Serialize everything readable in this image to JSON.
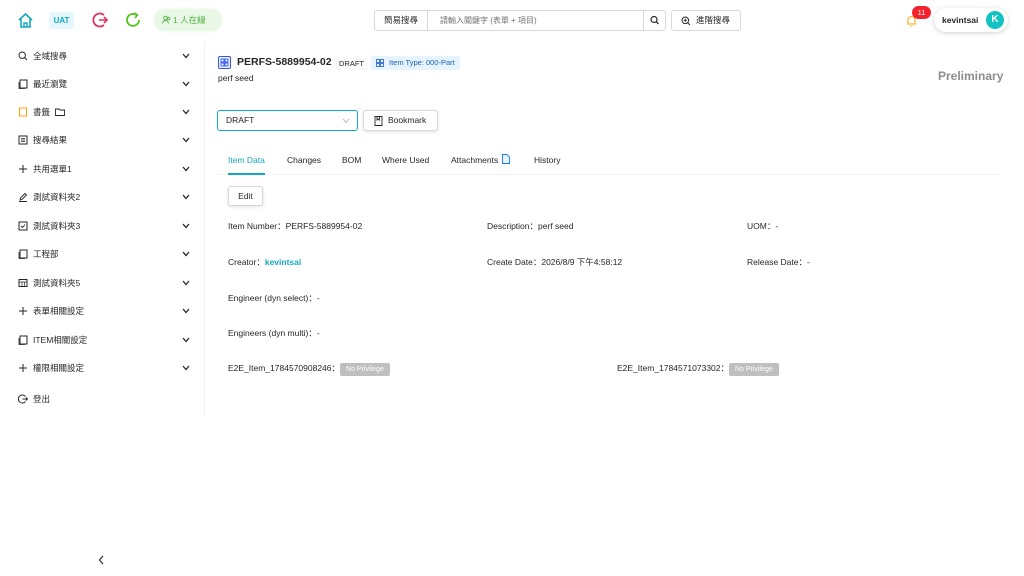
{
  "topbar": {
    "env_badge": "UAT",
    "online_users": "1 人在線",
    "search_mode": "簡易搜尋",
    "search_placeholder": "請輸入關鍵字 (表單 + 項目)",
    "advanced_search": "進階搜尋",
    "notification_count": "11",
    "username": "kevintsai",
    "avatar_initial": "K",
    "accent_color": "#13a8c2"
  },
  "sidebar": {
    "items": [
      {
        "label": "全域搜尋",
        "icon": "search-icon"
      },
      {
        "label": "最近瀏覽",
        "icon": "document-icon"
      },
      {
        "label": "書籤",
        "icon": "bookmark-icon"
      },
      {
        "label": "搜尋結果",
        "icon": "list-icon"
      },
      {
        "label": "共用選單1",
        "icon": "plus-icon"
      },
      {
        "label": "測試資料夾2",
        "icon": "pencil-icon"
      },
      {
        "label": "測試資料夾3",
        "icon": "checkbox-icon"
      },
      {
        "label": "工程部",
        "icon": "document-icon"
      },
      {
        "label": "測試資料夾5",
        "icon": "table-icon"
      },
      {
        "label": "表單相關設定",
        "icon": "plus-icon"
      },
      {
        "label": "ITEM相關設定",
        "icon": "document-icon"
      },
      {
        "label": "權限相關設定",
        "icon": "plus-icon"
      },
      {
        "label": "登出",
        "icon": "logout-icon"
      }
    ]
  },
  "item": {
    "number": "PERFS-5889954-02",
    "state_tag": "DRAFT",
    "type_tag": "Item Type: 000-Part",
    "description": "perf seed",
    "lifecycle": "Preliminary",
    "state_select": "DRAFT",
    "bookmark_label": "Bookmark"
  },
  "tabs": [
    "Item Data",
    "Changes",
    "BOM",
    "Where Used",
    "Attachments",
    "History"
  ],
  "edit_label": "Edit",
  "fields": {
    "item_number": {
      "label": "Item Number：",
      "value": "PERFS-5889954-02"
    },
    "description": {
      "label": "Description：",
      "value": "perf seed"
    },
    "uom": {
      "label": "UOM：",
      "value": "-"
    },
    "creator": {
      "label": "Creator：",
      "value": "kevintsai"
    },
    "create_date": {
      "label": "Create Date：",
      "value": "2026/8/9 下午4:58:12"
    },
    "release_date": {
      "label": "Release Date：",
      "value": "-"
    },
    "engineer_select": {
      "label": "Engineer (dyn select)：",
      "value": "-"
    },
    "engineers_multi": {
      "label": "Engineers (dyn multi)：",
      "value": "-"
    },
    "e2e_1": {
      "label": "E2E_Item_1784570908246：",
      "value": "No Privilege"
    },
    "e2e_2": {
      "label": "E2E_Item_1784571073302：",
      "value": "No Privilege"
    }
  }
}
